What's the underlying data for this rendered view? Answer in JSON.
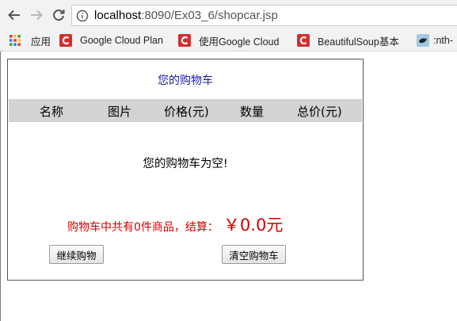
{
  "browser": {
    "url_host": "localhost",
    "url_rest": ":8090/Ex03_6/shopcar.jsp"
  },
  "bookmarks": [
    {
      "label": "应用",
      "icon": "apps-grid-icon"
    },
    {
      "label": "Google Cloud Plan",
      "icon": "c-logo-icon"
    },
    {
      "label": "使用Google Cloud",
      "icon": "c-logo-icon"
    },
    {
      "label": "BeautifulSoup基本",
      "icon": "c-logo-icon"
    },
    {
      "label": ":nth-",
      "icon": "bird-icon"
    }
  ],
  "cart": {
    "title": "您的购物车",
    "columns": [
      "名称",
      "图片",
      "价格(元)",
      "数量",
      "总价(元)"
    ],
    "empty_message": "您的购物车为空!",
    "summary_label": "购物车中共有0件商品，结算：",
    "summary_total": "￥0.0元",
    "continue_button": "继续购物",
    "clear_button": "清空购物车"
  },
  "colors": {
    "title": "#1a1aa8",
    "summary": "#d40000",
    "header_bg": "#d3d3d3",
    "bookmark_red": "#d32f2f"
  }
}
